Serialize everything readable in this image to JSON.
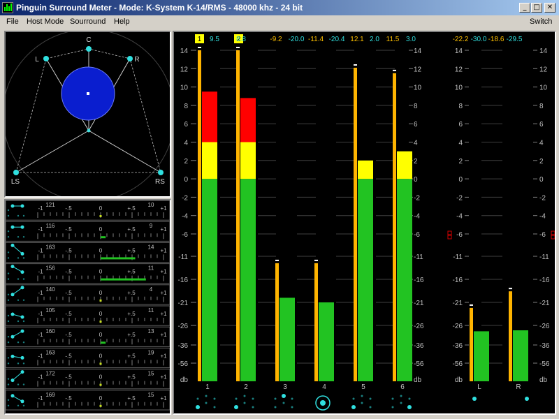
{
  "window": {
    "title": "Pinguin Surround Meter - Mode: K-System K-14/RMS - 48000 khz - 24 bit",
    "minimize_glyph": "_",
    "maximize_glyph": "□",
    "close_glyph": "✕"
  },
  "menu": {
    "file": "File",
    "host_mode": "Host Mode",
    "surround": "Sourround",
    "help": "Help",
    "switch": "Switch"
  },
  "surround": {
    "speakers": [
      "C",
      "L",
      "R",
      "LS",
      "RS"
    ]
  },
  "correlation": {
    "scale": [
      "-1",
      "-.5",
      "0",
      "+.5",
      "+1"
    ],
    "rows": [
      {
        "left": "121",
        "right": "10",
        "value": 0.0
      },
      {
        "left": "116",
        "right": "9",
        "value": 0.08
      },
      {
        "left": "163",
        "right": "14",
        "value": 0.55
      },
      {
        "left": "156",
        "right": "11",
        "value": 0.72
      },
      {
        "left": "140",
        "right": "4",
        "value": 0.0
      },
      {
        "left": "105",
        "right": "11",
        "value": 0.0
      },
      {
        "left": "160",
        "right": "13",
        "value": 0.08
      },
      {
        "left": "163",
        "right": "19",
        "value": 0.0
      },
      {
        "left": "172",
        "right": "15",
        "value": 0.0
      },
      {
        "left": "169",
        "right": "15",
        "value": 0.0
      }
    ]
  },
  "meters": {
    "scale_labels": [
      "14",
      "12",
      "10",
      "8",
      "6",
      "4",
      "2",
      "0",
      "-2",
      "-4",
      "-6",
      "-11",
      "-16",
      "-21",
      "-26",
      "-36",
      "-56",
      "db"
    ],
    "scale_values": [
      14,
      12,
      10,
      8,
      6,
      4,
      2,
      0,
      -2,
      -4,
      -6,
      -11,
      -16,
      -21,
      -26,
      -36,
      -56
    ],
    "peaks_main": [
      "9.5",
      "8.8",
      "-9.2",
      "-20.0",
      "-11.4",
      "-20.4",
      "12.1",
      "2.0",
      "11.5",
      "3.0"
    ],
    "peaks_side": [
      "-22.2",
      "-30.0",
      "-18.6",
      "-29.5"
    ],
    "overload_marks": [
      "1",
      "2"
    ],
    "colors": {
      "green": "#22c322",
      "yellow": "#ffff00",
      "red": "#ff0000",
      "peak": "#ffb400",
      "scale": "#c0c0c0",
      "peak_text": "#ffc000",
      "cyan": "#30e0e0"
    },
    "channels": [
      {
        "label": "1",
        "rms": 9.5,
        "peak": 14
      },
      {
        "label": "2",
        "rms": 8.8,
        "peak": 14
      },
      {
        "label": "3",
        "rms": -20.0,
        "peak": -12.5
      },
      {
        "label": "4",
        "rms": -21.0,
        "peak": -12.5
      },
      {
        "label": "5",
        "rms": 2.0,
        "peak": 12.1
      },
      {
        "label": "6",
        "rms": 3.0,
        "peak": 11.5
      }
    ],
    "side_channels": [
      {
        "label": "L",
        "rms": -29.0,
        "peak": -22.2
      },
      {
        "label": "R",
        "rms": -28.5,
        "peak": -18.6
      }
    ]
  }
}
